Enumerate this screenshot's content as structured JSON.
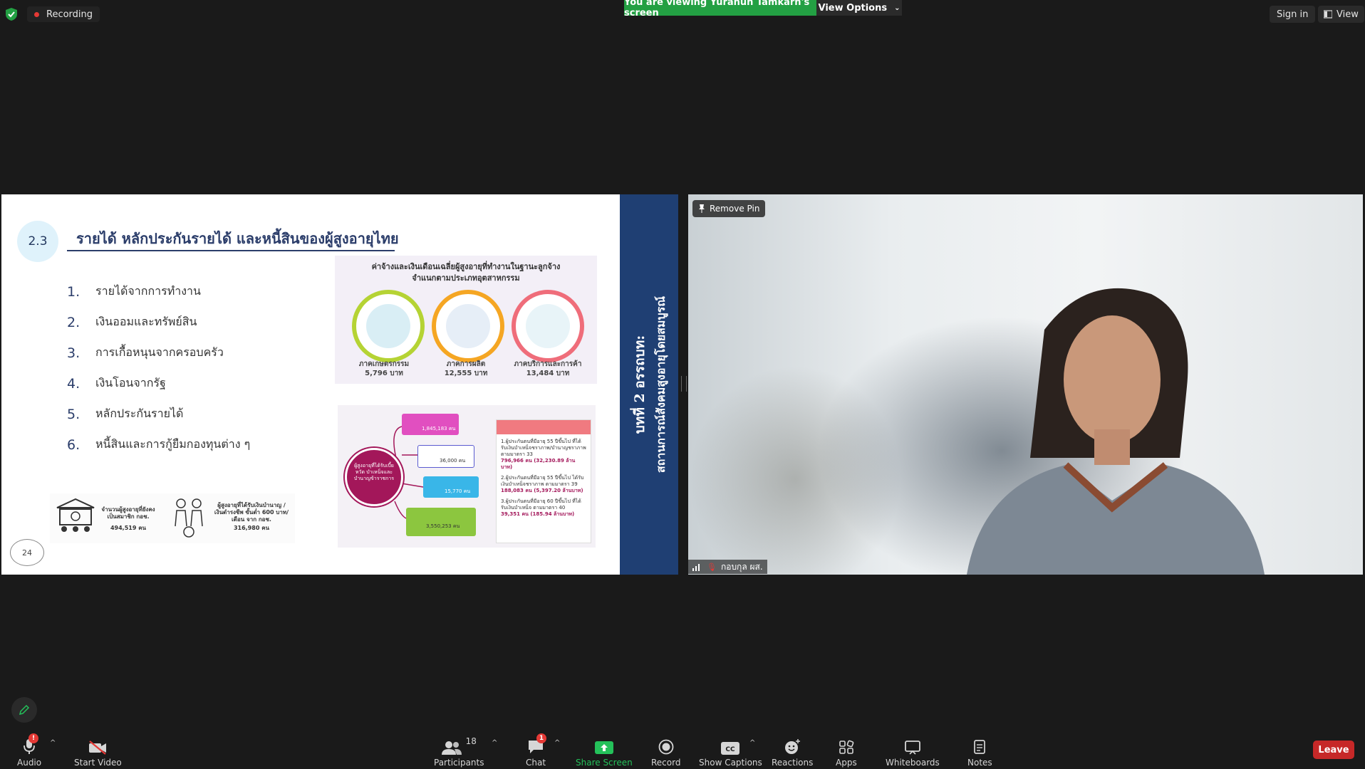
{
  "topbar": {
    "recording_label": "Recording",
    "viewing_banner": "You are viewing Yuranun Tamkarn's screen",
    "view_options": "View Options",
    "sign_in": "Sign in",
    "view": "View"
  },
  "slide": {
    "section_number": "2.3",
    "title": "รายได้ หลักประกันรายได้ และหนี้สินของผู้สูงอายุไทย",
    "list": [
      {
        "n": "1.",
        "text": "รายได้จากการทำงาน"
      },
      {
        "n": "2.",
        "text": "เงินออมและทรัพย์สิน"
      },
      {
        "n": "3.",
        "text": "การเกื้อหนุนจากครอบครัว"
      },
      {
        "n": "4.",
        "text": "เงินโอนจากรัฐ"
      },
      {
        "n": "5.",
        "text": "หลักประกันรายได้"
      },
      {
        "n": "6.",
        "text": "หนี้สินและการกู้ยืมกองทุนต่าง ๆ"
      }
    ],
    "side_title_1": "บทที่ 2 อรรถบท:",
    "side_title_2": "สถานการณ์สังคมสูงอายุโดยสมบูรณ์",
    "infographic1": {
      "heading_1": "ค่าจ้างและเงินเดือนเฉลี่ยผู้สูงอายุที่ทำงานในฐานะลูกจ้าง",
      "heading_2": "จำแนกตามประเภทอุตสาหกรรม",
      "sectors": [
        {
          "name": "ภาคเกษตรกรรม",
          "value": "5,796 บาท",
          "color": "#b5d334"
        },
        {
          "name": "ภาคการผลิต",
          "value": "12,555 บาท",
          "color": "#f5a623"
        },
        {
          "name": "ภาคบริการและการค้า",
          "value": "13,484 บาท",
          "color": "#ef6d7a"
        }
      ]
    },
    "infographic2": {
      "hub_text": "ผู้สูงอายุที่ได้รับเบี้ยหวัด บำเหน็จและบำนาญข้าราชการ",
      "boxes": [
        {
          "value": "1,845,183 คน",
          "color": "#e14fc0"
        },
        {
          "value": "36,000 คน",
          "color": "#5a5bd0"
        },
        {
          "value": "15,770 คน",
          "color": "#39b6e8"
        },
        {
          "value": "3,550,253 คน",
          "color": "#8cc63f"
        }
      ],
      "panel_items": [
        {
          "text": "1.ผู้ประกันตนที่มีอายุ 55 ปีขึ้นไป ที่ได้รับเงินบำเหน็จชราภาพ/บำนาญชราภาพ ตามมาตรา 33",
          "value": "796,966 คน (32,230.89 ล้านบาท)"
        },
        {
          "text": "2.ผู้ประกันตนที่มีอายุ 55 ปีขึ้นไป ได้รับเงินบำเหน็จชราภาพ ตามมาตรา 39",
          "value": "188,083 คน (5,397.20 ล้านบาท)"
        },
        {
          "text": "3.ผู้ประกันตนที่มีอายุ 60 ปีขึ้นไป ที่ได้รับเงินบำเหน็จ ตามมาตรา 40",
          "value": "39,351 คน (185.94 ล้านบาท)"
        }
      ]
    },
    "strip": {
      "left_label": "จำนวนผู้สูงอายุที่ยังคงเป็นสมาชิก กอช.",
      "left_value": "494,519 คน",
      "right_label": "ผู้สูงอายุที่ได้รับเงินบำนาญ / เงินดำรงชีพ ขั้นต่ำ 600 บาท/เดือน จาก กอช.",
      "right_value": "316,980 คน"
    },
    "page_number": "24"
  },
  "speaker": {
    "remove_pin": "Remove Pin",
    "name": "กอบกุล ผส."
  },
  "toolbar": {
    "audio": "Audio",
    "start_video": "Start Video",
    "participants": "Participants",
    "participants_count": "18",
    "chat": "Chat",
    "chat_badge": "1",
    "audio_badge": "!",
    "share_screen": "Share Screen",
    "record": "Record",
    "show_captions": "Show Captions",
    "reactions": "Reactions",
    "apps": "Apps",
    "whiteboards": "Whiteboards",
    "notes": "Notes",
    "leave": "Leave"
  },
  "colors": {
    "share_green": "#23a043",
    "leave_red": "#c62828",
    "slide_navy": "#1f3f73"
  }
}
